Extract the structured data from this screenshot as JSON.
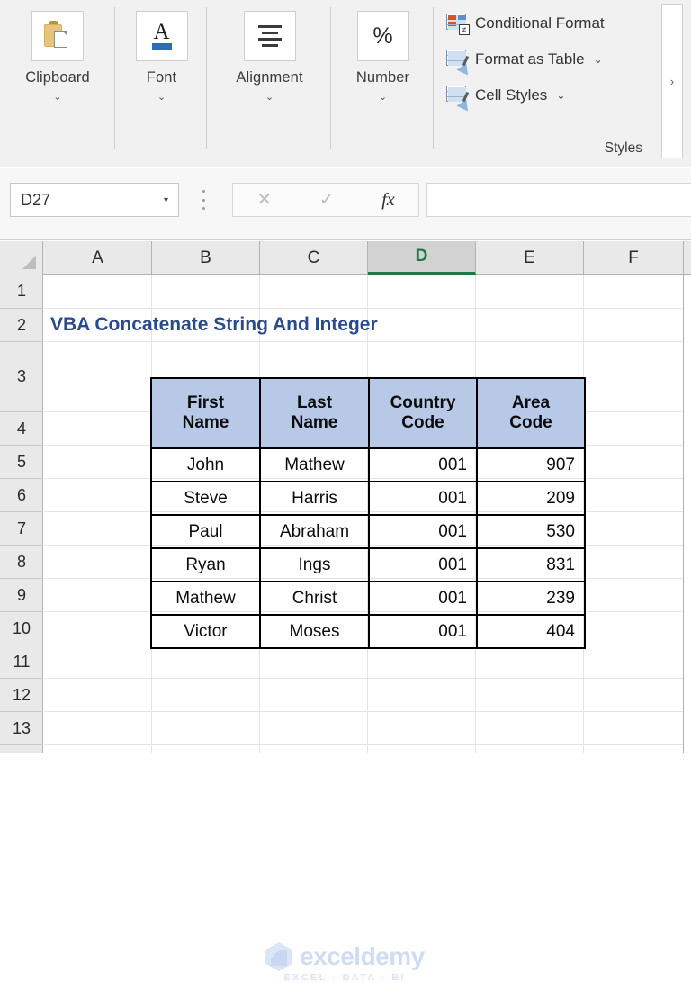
{
  "ribbon": {
    "groups": [
      {
        "label": "Clipboard",
        "icon": "clipboard-icon",
        "caret": "⌄"
      },
      {
        "label": "Font",
        "icon": "font-a-icon",
        "caret": "⌄"
      },
      {
        "label": "Alignment",
        "icon": "alignment-icon",
        "caret": "⌄"
      },
      {
        "label": "Number",
        "icon": "percent-icon",
        "caret": "⌄"
      }
    ],
    "percent_symbol": "%",
    "font_letter": "A",
    "styles": {
      "group_label": "Styles",
      "items": [
        {
          "label": "Conditional Format",
          "icon": "conditional-formatting-icon",
          "caret": ""
        },
        {
          "label": "Format as Table",
          "icon": "format-as-table-icon",
          "caret": "⌄"
        },
        {
          "label": "Cell Styles",
          "icon": "cell-styles-icon",
          "caret": "⌄"
        }
      ]
    },
    "overflow_label": "›"
  },
  "formula_bar": {
    "name_box_value": "D27",
    "name_box_caret": "▾",
    "cancel_icon": "✕",
    "enter_icon": "✓",
    "function_icon": "fx",
    "formula_value": ""
  },
  "grid": {
    "columns": [
      "A",
      "B",
      "C",
      "D",
      "E",
      "F"
    ],
    "selected_column": "D",
    "rows": [
      "1",
      "2",
      "3",
      "4",
      "5",
      "6",
      "7",
      "8",
      "9",
      "10",
      "11",
      "12",
      "13"
    ],
    "title": "VBA Concatenate String And Integer",
    "title_color": "#2b4a8b"
  },
  "table": {
    "header_bg": "#b8c9e8",
    "headers": [
      "First Name",
      "Last Name",
      "Country Code",
      "Area Code"
    ],
    "headers_lines": [
      [
        "First",
        "Name"
      ],
      [
        "Last",
        "Name"
      ],
      [
        "Country",
        "Code"
      ],
      [
        "Area",
        "Code"
      ]
    ],
    "rows": [
      {
        "first": "John",
        "last": "Mathew",
        "country": "001",
        "area": "907"
      },
      {
        "first": "Steve",
        "last": "Harris",
        "country": "001",
        "area": "209"
      },
      {
        "first": "Paul",
        "last": "Abraham",
        "country": "001",
        "area": "530"
      },
      {
        "first": "Ryan",
        "last": "Ings",
        "country": "001",
        "area": "831"
      },
      {
        "first": "Mathew",
        "last": "Christ",
        "country": "001",
        "area": "239"
      },
      {
        "first": "Victor",
        "last": "Moses",
        "country": "001",
        "area": "404"
      }
    ]
  },
  "watermark": {
    "name": "exceldemy",
    "tagline": "EXCEL · DATA · BI"
  }
}
